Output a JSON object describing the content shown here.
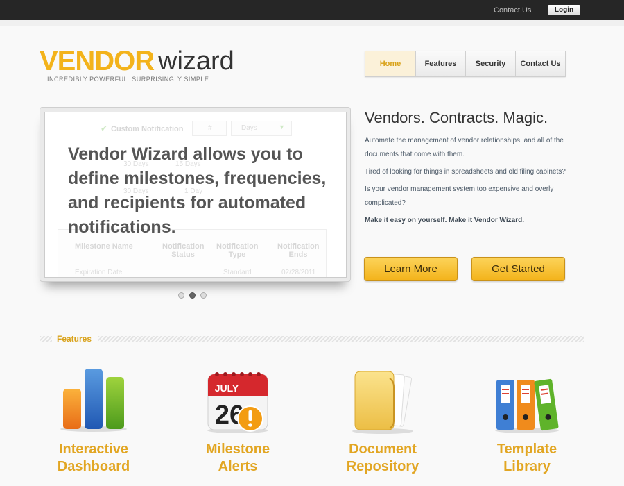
{
  "topbar": {
    "contact_label": "Contact Us",
    "separator": "|",
    "login_label": "Login"
  },
  "logo": {
    "part1": "VENDOR",
    "part2": "wizard",
    "tagline": "INCREDIBLY POWERFUL. SURPRISINGLY SIMPLE."
  },
  "nav": {
    "items": [
      {
        "label": "Home",
        "active": true
      },
      {
        "label": "Features"
      },
      {
        "label": "Security"
      },
      {
        "label": "Contact Us"
      }
    ]
  },
  "slider": {
    "headline": "Vendor Wizard allows you to define milestones, frequencies, and recipients for automated notifications.",
    "background": {
      "custom_notification": "Custom Notification",
      "days_value": "#",
      "days_select": "Days",
      "option_30": "30 Days",
      "option_15": "15 Days",
      "option_1": "1 Day",
      "table_headers": [
        "Milestone Name",
        "Notification Status",
        "Notification Type",
        "Notification Ends"
      ],
      "table_row": [
        "Expiration Date",
        "",
        "Standard",
        "02/28/2011"
      ]
    },
    "dots": [
      {
        "active": false
      },
      {
        "active": true
      },
      {
        "active": false
      }
    ]
  },
  "intro": {
    "headline": "Vendors. Contracts. Magic.",
    "p1": "Automate the management of vendor relationships, and all of the documents that come with them.",
    "p2": "Tired of looking for things in spreadsheets and old filing cabinets?",
    "p3": "Is your vendor management system too expensive and overly complicated?",
    "p4": "Make it easy on yourself. Make it Vendor Wizard."
  },
  "cta": {
    "learn_more": "Learn More",
    "get_started": "Get Started"
  },
  "features": {
    "heading": "Features",
    "items": [
      {
        "label1": "Interactive",
        "label2": "Dashboard",
        "icon": "bar-chart-icon"
      },
      {
        "label1": "Milestone",
        "label2": "Alerts",
        "icon": "calendar-alert-icon",
        "month": "JULY",
        "day": "26"
      },
      {
        "label1": "Document",
        "label2": "Repository",
        "icon": "folder-icon"
      },
      {
        "label1": "Template",
        "label2": "Library",
        "icon": "binders-icon"
      }
    ]
  },
  "colors": {
    "accent": "#f3b31b",
    "topbar": "#262626",
    "feature_label": "#e2a623"
  }
}
